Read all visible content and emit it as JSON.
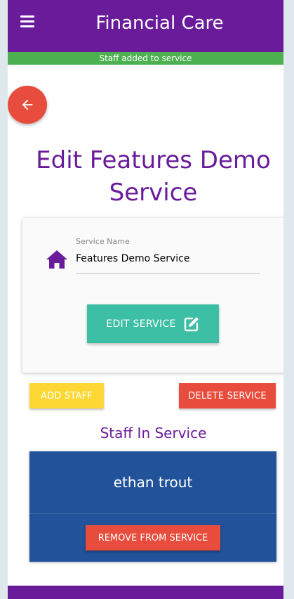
{
  "header": {
    "title": "Financial Care",
    "menu_icon": "hamburger-menu-icon"
  },
  "status": {
    "message": "Staff added to service",
    "color": "#4caf50"
  },
  "back_button": {
    "icon": "arrow-left-icon"
  },
  "page": {
    "title": "Edit Features Demo Service"
  },
  "form": {
    "field_icon": "home-icon",
    "service_name_label": "Service Name",
    "service_name_value": "Features Demo Service",
    "edit_button_label": "EDIT SERVICE",
    "edit_icon": "edit-icon"
  },
  "actions": {
    "add_staff_label": "ADD STAFF",
    "delete_service_label": "DELETE SERVICE"
  },
  "staff_section": {
    "title": "Staff In Service",
    "members": [
      {
        "name": "ethan trout",
        "remove_label": "REMOVE FROM SERVICE"
      }
    ]
  },
  "colors": {
    "primary": "#6a1b9a",
    "success": "#4caf50",
    "danger": "#e84c3d",
    "teal": "#3cbfa4",
    "yellow": "#fdd835",
    "staff_card": "#21529a"
  }
}
